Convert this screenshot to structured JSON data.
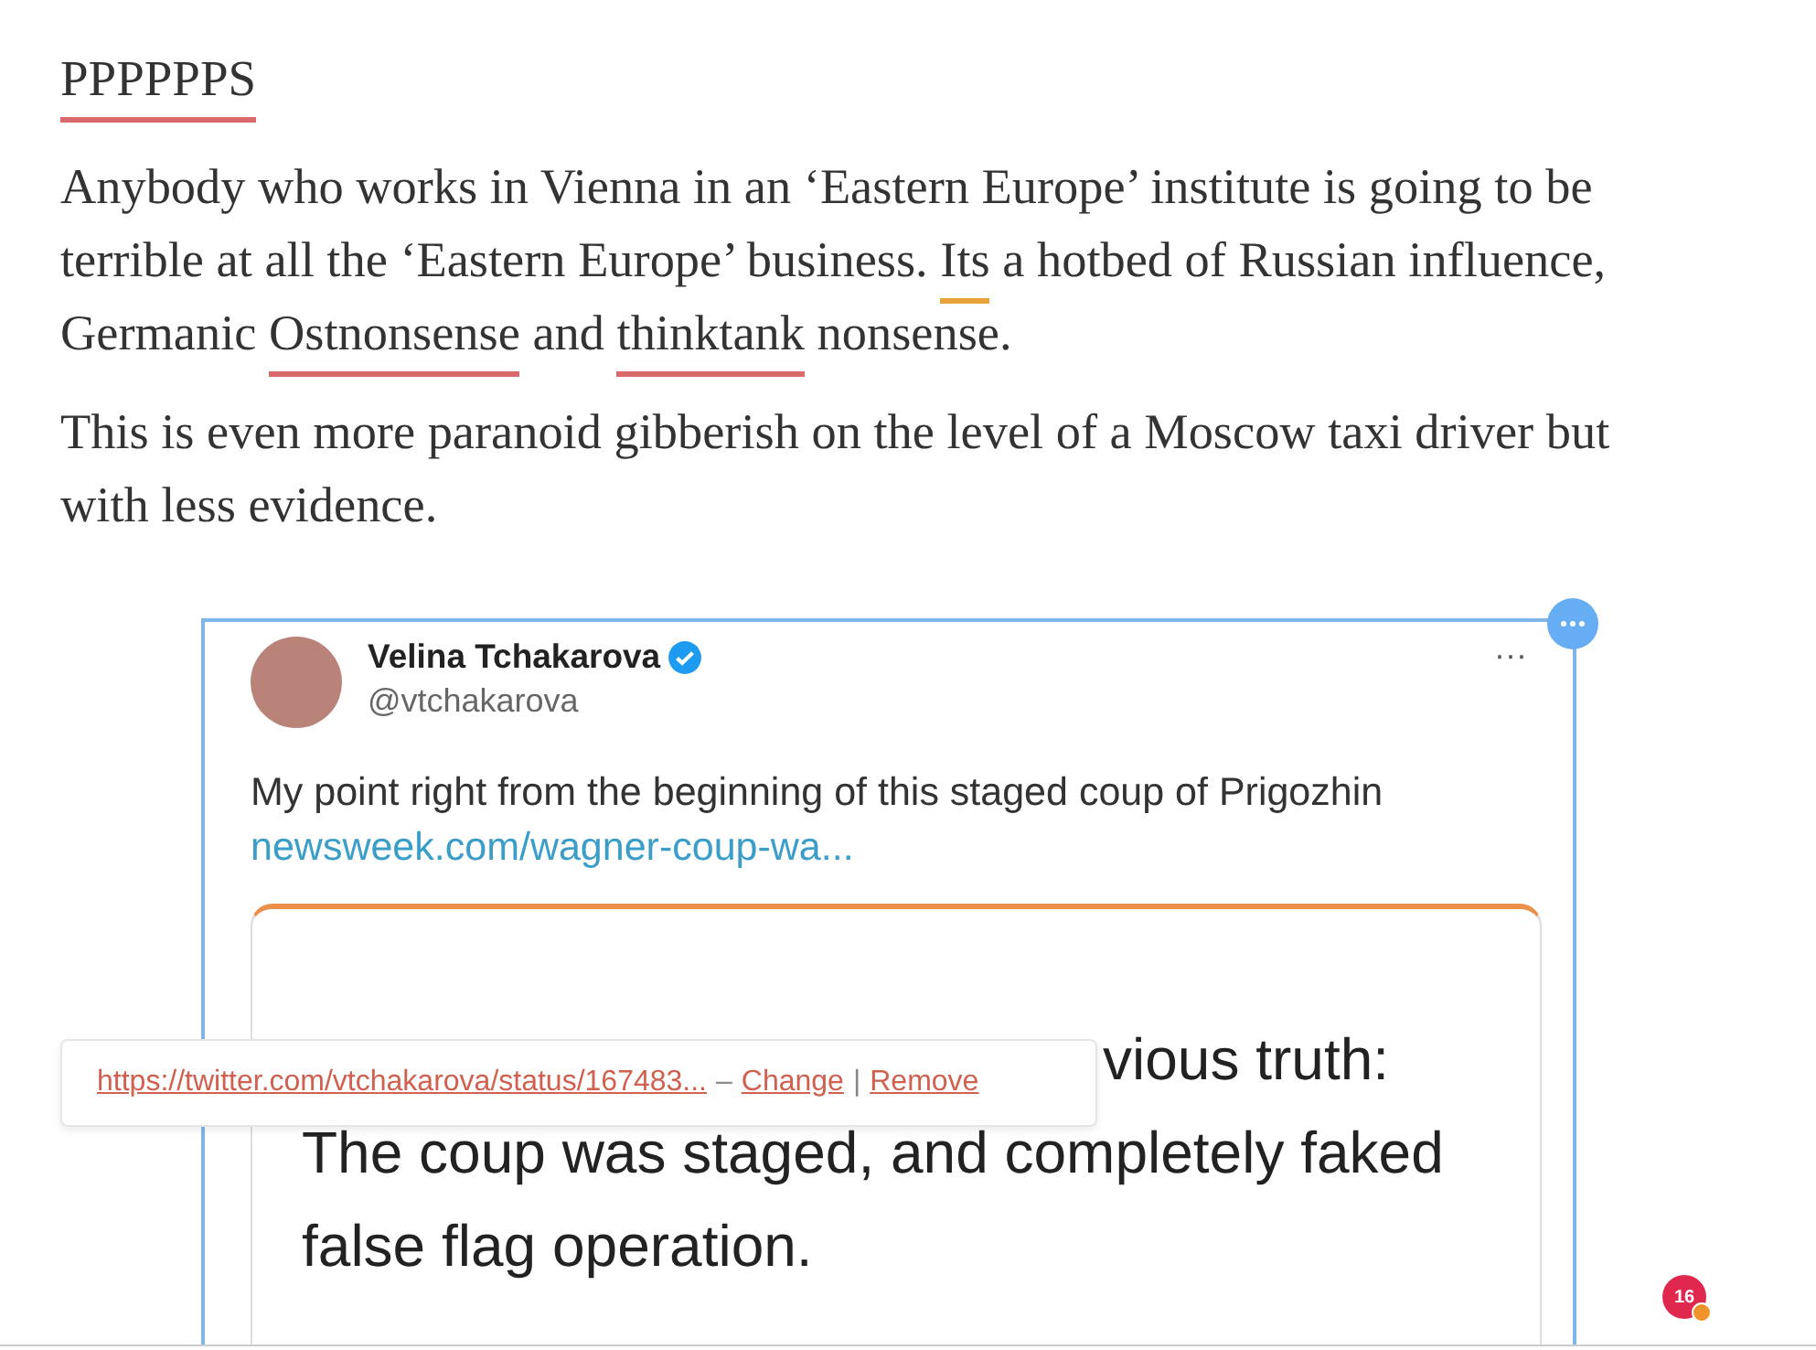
{
  "heading": {
    "text": "PPPPPPS",
    "color": "#d9696b"
  },
  "paragraphs": [
    [
      {
        "text": "Anybody who works in Vienna in an ‘Eastern Europe’ institute is going to be terrible at all the ‘Eastern Europe’ business. "
      },
      {
        "text": "Its",
        "color": "#e8a23a"
      },
      {
        "text": " a hotbed of Russian influence, Germanic "
      },
      {
        "text": "Ostnonsense",
        "color": "#d9696b"
      },
      {
        "text": " and "
      },
      {
        "text": "thinktank",
        "color": "#d9696b"
      },
      {
        "text": " nonsense."
      }
    ],
    [
      {
        "text": "This is even more paranoid gibberish on the level of a Moscow taxi driver but with less evidence."
      }
    ]
  ],
  "embed": {
    "selected": true,
    "author": "Velina Tchakarova",
    "verified": true,
    "handle": "@vtchakarova",
    "more": "···",
    "text": "My point right from the beginning of this staged coup of Prigozhin",
    "link": "newsweek.com/wagner-coup-wa...",
    "card_lines": [
      {
        "text": "vious truth:",
        "kind": "partial"
      },
      {
        "text": "The coup was staged, and completely faked",
        "kind": "full"
      },
      {
        "text": "false flag operation.",
        "kind": "full"
      }
    ]
  },
  "link_tooltip": {
    "url": "https://twitter.com/vtchakarova/status/167483...",
    "dash": "–",
    "change": "Change",
    "sep": "|",
    "remove": "Remove"
  },
  "notification_badge": {
    "count": "16"
  }
}
